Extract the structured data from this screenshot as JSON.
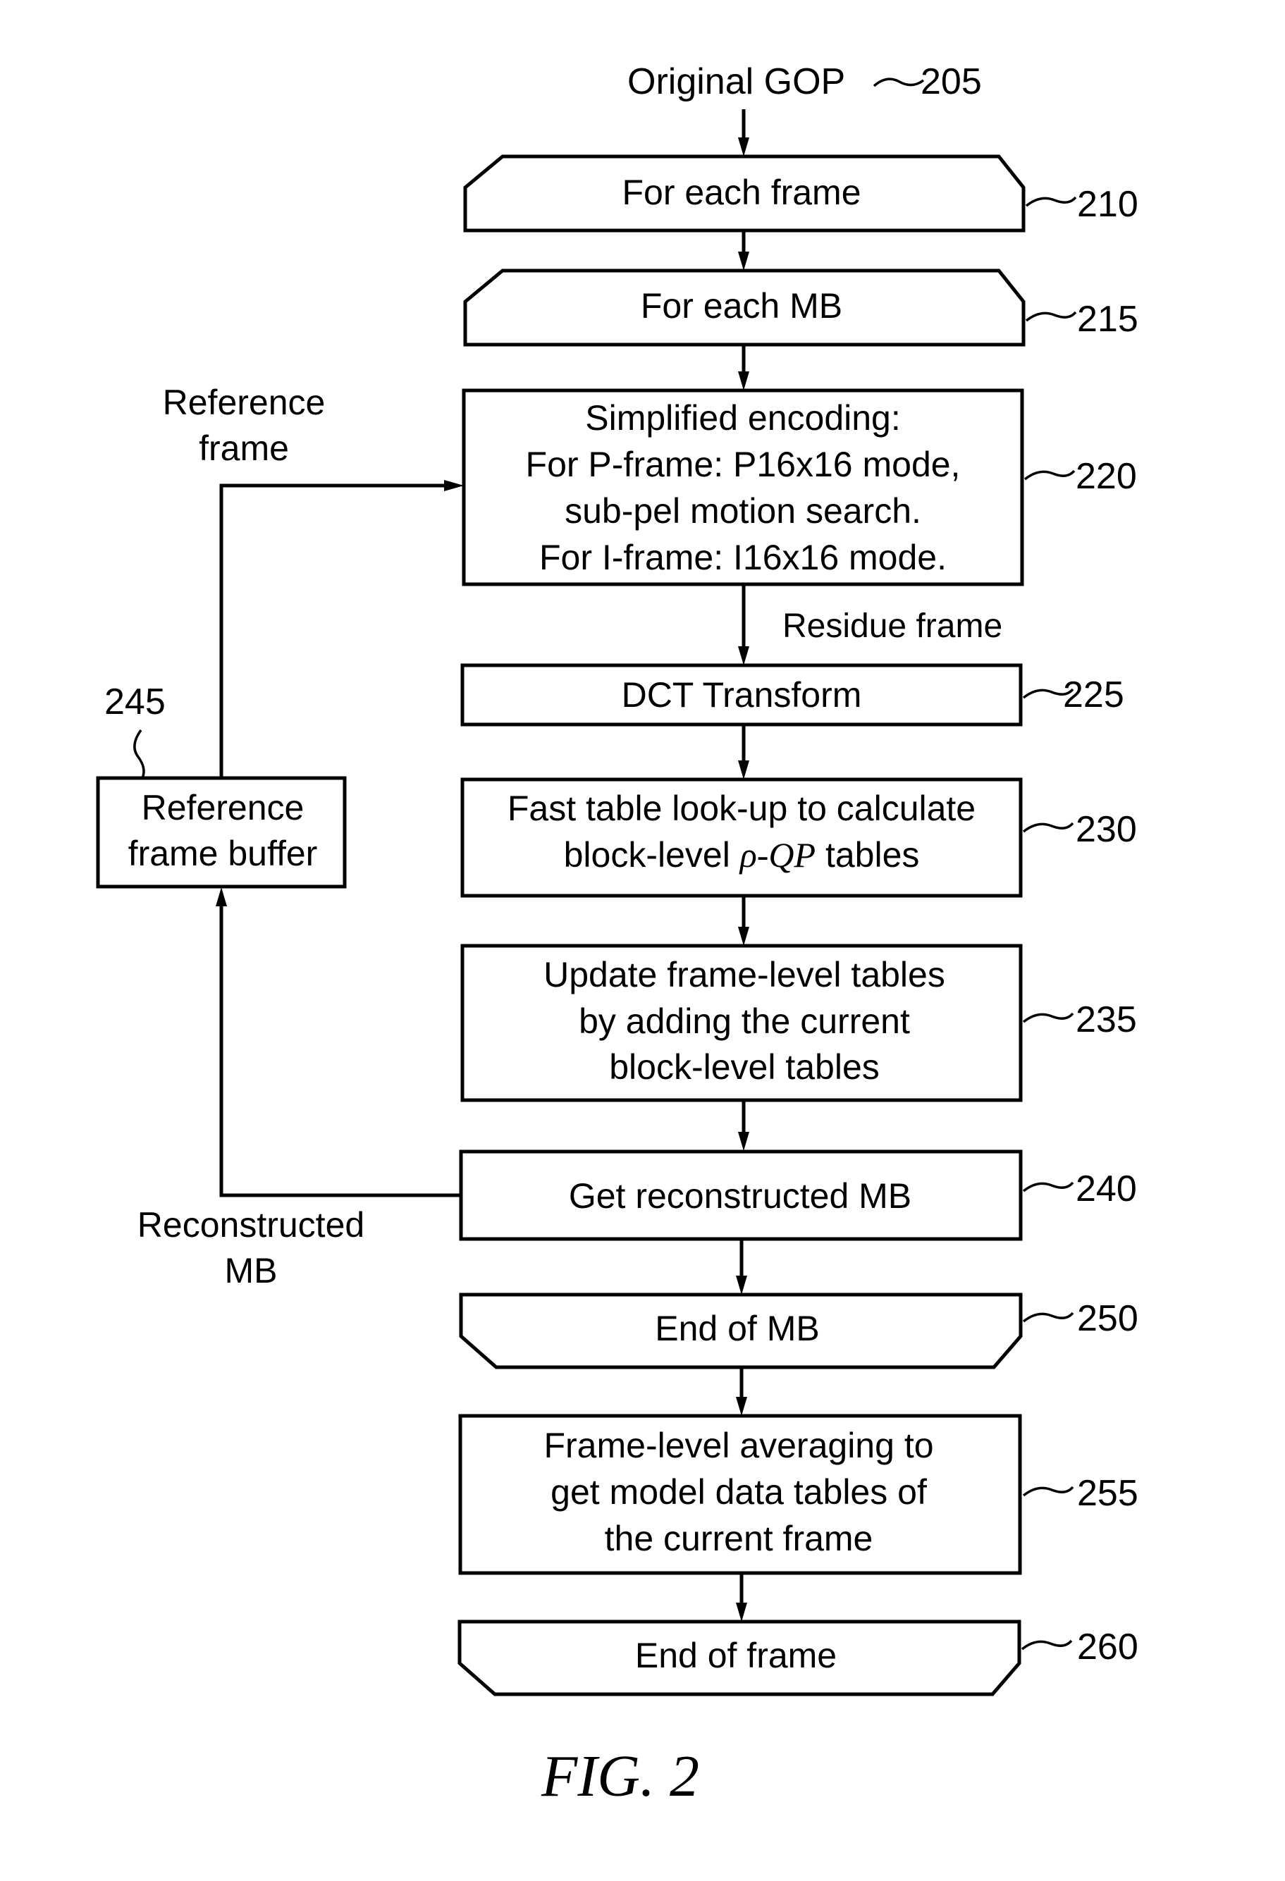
{
  "figure": {
    "caption": "FIG. 2",
    "input_label": "Original GOP",
    "input_ref": "205",
    "edge_labels": {
      "reference_frame_line1": "Reference",
      "reference_frame_line2": "frame",
      "residue_frame": "Residue frame",
      "reconstructed_mb_line1": "Reconstructed",
      "reconstructed_mb_line2": "MB"
    },
    "nodes": [
      {
        "ref": "210",
        "shape": "loop-start",
        "lines": [
          "For each frame"
        ]
      },
      {
        "ref": "215",
        "shape": "loop-start",
        "lines": [
          "For each MB"
        ]
      },
      {
        "ref": "220",
        "shape": "process",
        "lines": [
          "Simplified encoding:",
          "For P-frame: P16x16 mode,",
          "sub-pel motion search.",
          "For I-frame: I16x16 mode."
        ]
      },
      {
        "ref": "225",
        "shape": "process",
        "lines": [
          "DCT Transform"
        ]
      },
      {
        "ref": "230",
        "shape": "process",
        "lines": [
          "Fast table look-up to calculate",
          "block-level",
          "ρ-QP",
          "tables"
        ]
      },
      {
        "ref": "235",
        "shape": "process",
        "lines": [
          "Update frame-level tables",
          "by adding the current",
          "block-level tables"
        ]
      },
      {
        "ref": "240",
        "shape": "process",
        "lines": [
          "Get reconstructed MB"
        ]
      },
      {
        "ref": "250",
        "shape": "loop-end",
        "lines": [
          "End of MB"
        ]
      },
      {
        "ref": "255",
        "shape": "process",
        "lines": [
          "Frame-level averaging to",
          "get model data tables of",
          "the current frame"
        ]
      },
      {
        "ref": "260",
        "shape": "loop-end",
        "lines": [
          "End of frame"
        ]
      },
      {
        "ref": "245",
        "shape": "process",
        "lines": [
          "Reference",
          "frame buffer"
        ]
      }
    ]
  }
}
